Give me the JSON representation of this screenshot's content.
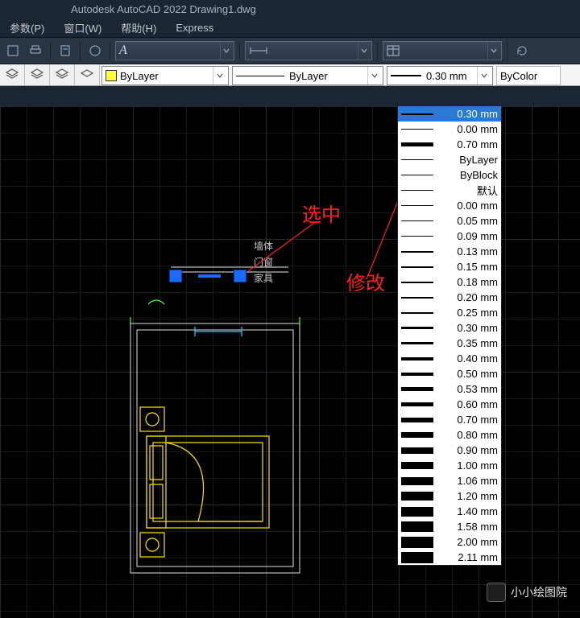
{
  "app": {
    "title": "Autodesk AutoCAD 2022   Drawing1.dwg"
  },
  "menu": {
    "items": [
      "参数(P)",
      "窗口(W)",
      "帮助(H)",
      "Express"
    ]
  },
  "property_bar": {
    "color": {
      "label": "ByLayer",
      "swatch": "#ffff33"
    },
    "linetype": {
      "label": "ByLayer"
    },
    "lineweight": {
      "label": "0.30 mm"
    },
    "plotstyle": {
      "label": "ByColor"
    }
  },
  "lineweight_options": {
    "highlight_index": 0,
    "items": [
      {
        "label": "0.30 mm",
        "thick": 2
      },
      {
        "label": "0.00 mm",
        "thick": 1
      },
      {
        "label": "0.70 mm",
        "thick": 5
      },
      {
        "label": "ByLayer",
        "thick": 1
      },
      {
        "label": "ByBlock",
        "thick": 1
      },
      {
        "label": "默认",
        "thick": 1
      },
      {
        "label": "0.00 mm",
        "thick": 1
      },
      {
        "label": "0.05 mm",
        "thick": 1
      },
      {
        "label": "0.09 mm",
        "thick": 1
      },
      {
        "label": "0.13 mm",
        "thick": 2
      },
      {
        "label": "0.15 mm",
        "thick": 2
      },
      {
        "label": "0.18 mm",
        "thick": 2
      },
      {
        "label": "0.20 mm",
        "thick": 2
      },
      {
        "label": "0.25 mm",
        "thick": 2
      },
      {
        "label": "0.30 mm",
        "thick": 3
      },
      {
        "label": "0.35 mm",
        "thick": 3
      },
      {
        "label": "0.40 mm",
        "thick": 4
      },
      {
        "label": "0.50 mm",
        "thick": 4
      },
      {
        "label": "0.53 mm",
        "thick": 5
      },
      {
        "label": "0.60 mm",
        "thick": 5
      },
      {
        "label": "0.70 mm",
        "thick": 6
      },
      {
        "label": "0.80 mm",
        "thick": 7
      },
      {
        "label": "0.90 mm",
        "thick": 8
      },
      {
        "label": "1.00 mm",
        "thick": 9
      },
      {
        "label": "1.06 mm",
        "thick": 10
      },
      {
        "label": "1.20 mm",
        "thick": 11
      },
      {
        "label": "1.40 mm",
        "thick": 12
      },
      {
        "label": "1.58 mm",
        "thick": 13
      },
      {
        "label": "2.00 mm",
        "thick": 14
      },
      {
        "label": "2.11 mm",
        "thick": 14
      }
    ]
  },
  "annotations": {
    "select": "选中",
    "modify": "修改",
    "layer_labels": [
      "墙体",
      "门窗",
      "家具"
    ]
  },
  "watermark": {
    "text": "小小绘图院"
  }
}
